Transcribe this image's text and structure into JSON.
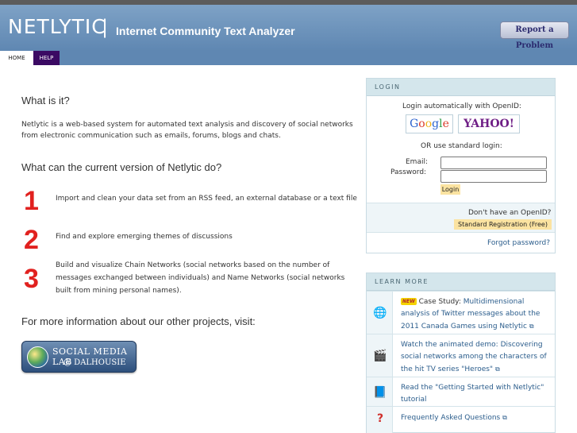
{
  "header": {
    "logo": "NETLYTIC",
    "separator": "|",
    "tagline": "Internet Community Text Analyzer",
    "report_button": "Report a Problem"
  },
  "nav": {
    "home": "HOME",
    "help": "HELP"
  },
  "main": {
    "what_title": "What is it?",
    "what_text_1": "Netlytic is a web-based system for automated text analysis and discovery of social networks",
    "what_text_2": "from electronic communication such as emails, forums, blogs and chats.",
    "can_title": "What can the current version of Netlytic do?",
    "features": [
      {
        "number": "1",
        "lines": [
          "Import and clean your data set from an RSS feed, an external database or a text file"
        ]
      },
      {
        "number": "2",
        "lines": [
          "Find and explore emerging themes of discussions"
        ]
      },
      {
        "number": "3",
        "lines": [
          "Build and visualize Chain Networks (social networks based on the number of",
          "messages exchanged between individuals) and Name Networks (social networks",
          "built from mining personal names)."
        ]
      }
    ],
    "more_title": "For more information about our other projects, visit:",
    "sml_logo_line1": "SOCIAL MEDIA LAB",
    "sml_logo_line2": "@ DALHOUSIE"
  },
  "login": {
    "heading": "LOGIN",
    "openid_text": "Login automatically with OpenID:",
    "google": [
      "G",
      "o",
      "o",
      "g",
      "l",
      "e"
    ],
    "yahoo": "YAHOO!",
    "or_text": "OR use standard login:",
    "email_label": "Email:",
    "password_label": "Password:",
    "login_button": "Login",
    "no_openid": "Don't have an OpenID?",
    "register_button": "Standard Registration (Free)",
    "forgot": "Forgot password?"
  },
  "learn_more": {
    "heading": "LEARN MORE",
    "new_badge": "NEW",
    "items": [
      {
        "prefix": " Case Study: ",
        "link": "Multidimensional analysis of Twitter messages about the 2011 Canada Games using Netlytic",
        "icon": "globe-icon"
      },
      {
        "prefix": "",
        "link": "Watch the animated demo: Discovering social networks among the characters of the hit TV series \"Heroes\"",
        "icon": "film-icon"
      },
      {
        "prefix": "",
        "link": "Read the \"Getting Started with Netlytic\" tutorial",
        "icon": "book-icon"
      },
      {
        "prefix": "",
        "link": "Frequently Asked Questions",
        "icon": "question-icon"
      }
    ]
  },
  "colors": {
    "header": "#5f87b2",
    "nav_help": "#3b0a63",
    "accent_number": "#e1211f",
    "link": "#2b5d8c",
    "button_highlight": "#fbe3a1"
  }
}
